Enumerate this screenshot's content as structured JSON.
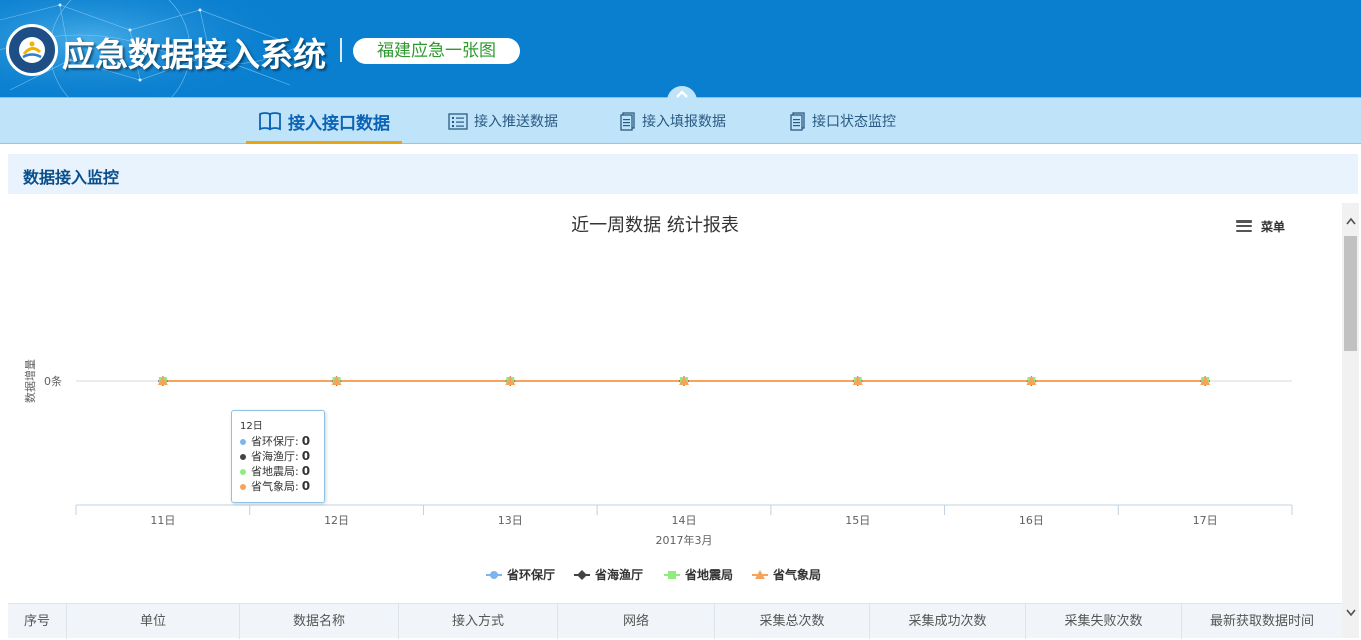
{
  "header": {
    "title": "应急数据接入系统",
    "subtitle": "福建应急一张图",
    "colors": {
      "background": "#0a7fcf",
      "subtitle_text": "#2c9a2c"
    }
  },
  "nav": {
    "items": [
      {
        "label": "接入接口数据",
        "icon": "book-icon",
        "active": true
      },
      {
        "label": "接入推送数据",
        "icon": "list-icon",
        "active": false
      },
      {
        "label": "接入填报数据",
        "icon": "document-icon",
        "active": false
      },
      {
        "label": "接口状态监控",
        "icon": "document-icon",
        "active": false
      }
    ],
    "active_underline_color": "#e9a514"
  },
  "section": {
    "title": "数据接入监控"
  },
  "chart": {
    "menu_label": "菜单",
    "tooltip": {
      "header": "12日",
      "rows": [
        {
          "name": "省环保厅",
          "value": "0"
        },
        {
          "name": "省海渔厅",
          "value": "0"
        },
        {
          "name": "省地震局",
          "value": "0"
        },
        {
          "name": "省气象局",
          "value": "0"
        }
      ]
    }
  },
  "chart_data": {
    "type": "line",
    "title": "近一周数据 统计报表",
    "xlabel": "2017年3月",
    "ylabel": "数据增量",
    "y_tick_labels": [
      "0条"
    ],
    "categories": [
      "11日",
      "12日",
      "13日",
      "14日",
      "15日",
      "16日",
      "17日"
    ],
    "series": [
      {
        "name": "省环保厅",
        "values": [
          0,
          0,
          0,
          0,
          0,
          0,
          0
        ],
        "color": "#7cb5ec",
        "marker": "circle"
      },
      {
        "name": "省海渔厅",
        "values": [
          0,
          0,
          0,
          0,
          0,
          0,
          0
        ],
        "color": "#434348",
        "marker": "diamond"
      },
      {
        "name": "省地震局",
        "values": [
          0,
          0,
          0,
          0,
          0,
          0,
          0
        ],
        "color": "#90ed7d",
        "marker": "square"
      },
      {
        "name": "省气象局",
        "values": [
          0,
          0,
          0,
          0,
          0,
          0,
          0
        ],
        "color": "#f7a35c",
        "marker": "triangle"
      }
    ],
    "legend_position": "bottom-center",
    "grid": true
  },
  "table": {
    "columns": [
      "序号",
      "单位",
      "数据名称",
      "接入方式",
      "网络",
      "采集总次数",
      "采集成功次数",
      "采集失败次数",
      "最新获取数据时间"
    ]
  }
}
